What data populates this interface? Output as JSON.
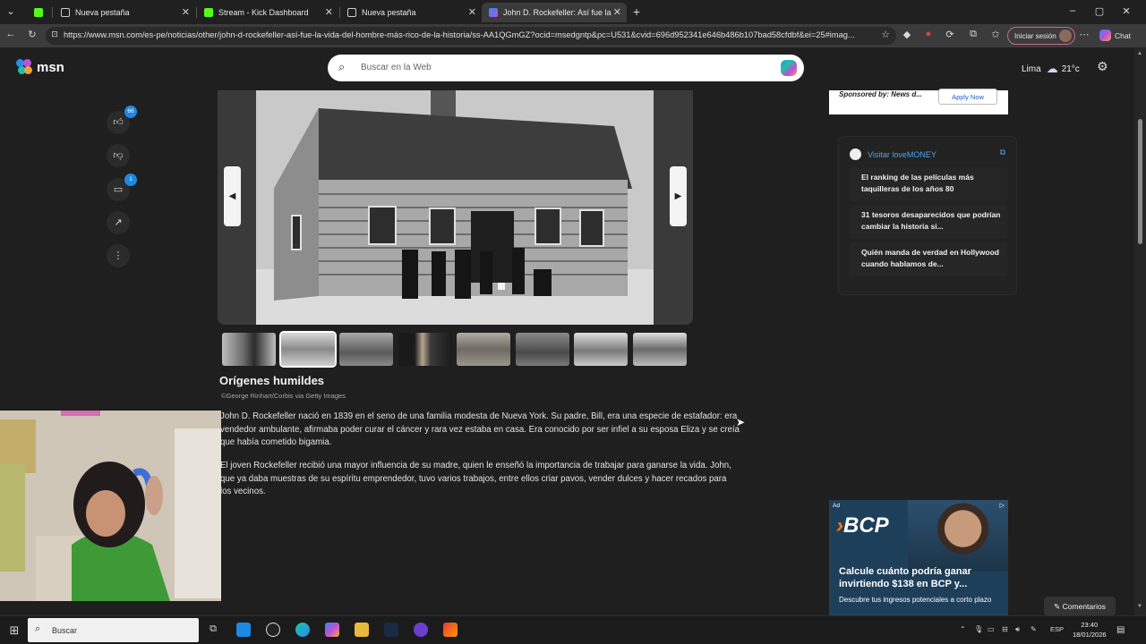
{
  "browser": {
    "tabs": [
      {
        "label": "",
        "color": "#53fc18"
      },
      {
        "label": "Nueva pestaña",
        "color": "#cfcfcf"
      },
      {
        "label": "Stream - Kick Dashboard",
        "color": "#53fc18"
      },
      {
        "label": "Nueva pestaña",
        "color": "#cfcfcf"
      },
      {
        "label": "John D. Rockefeller: Así fue la vida",
        "color": "#c04fd8",
        "active": true
      }
    ],
    "url": "https://www.msn.com/es-pe/noticias/other/john-d-rockefeller-así-fue-la-vida-del-hombre-más-rico-de-la-historia/ss-AA1QGmGZ?ocid=msedgntp&pc=U531&cvid=696d952341e646b486b107bad58cfdbf&ei=25#imag...",
    "signin_label": "Iniciar sesión",
    "chat_label": "Chat"
  },
  "msn": {
    "logo_text": "msn",
    "search_placeholder": "Buscar en la Web",
    "weather_city": "Lima",
    "weather_temp": "21°c"
  },
  "article_actions": {
    "likes_count": "66",
    "comments_count": "1"
  },
  "gallery": {
    "caption_title": "Orígenes humildes",
    "caption_credit": "©George Rinhart/Corbis via Getty Images",
    "paragraphs": [
      "John D. Rockefeller nació en 1839 en el seno de una familia modesta de Nueva York. Su padre, Bill, era una especie de estafador: era vendedor ambulante, afirmaba poder curar el cáncer y rara vez estaba en casa. Era conocido por ser infiel a su esposa Eliza y se creía que había cometido bigamia.",
      "El joven Rockefeller recibió una mayor influencia de su madre, quien le enseñó la importancia de trabajar para ganarse la vida. John, que ya daba muestras de su espíritu emprendedor, tuvo varios trabajos, entre ellos criar pavos, vender dulces y hacer recados para los vecinos."
    ]
  },
  "right_rail": {
    "sponsor_text": "Sponsored by: News d...",
    "apply_label": "Apply Now",
    "lovemoney_title": "Visitar loveMONEY",
    "lovemoney_items": [
      "El ranking de las películas más taquilleras de los años 80",
      "31 tesoros desaparecidos que podrían cambiar la historia si...",
      "Quién manda de verdad en Hollywood cuando hablamos de..."
    ],
    "ad_label": "Ad",
    "ad_brand": "BCP",
    "ad_headline": "Calcule cuánto podría ganar invirtiendo $138 en BCP y...",
    "ad_sub": "Descubre tus ingresos potenciales a corto plazo"
  },
  "comments_label": "Comentarios",
  "taskbar": {
    "search_label": "Buscar",
    "lang": "ESP",
    "time": "23:40",
    "date": "18/01/2026"
  }
}
